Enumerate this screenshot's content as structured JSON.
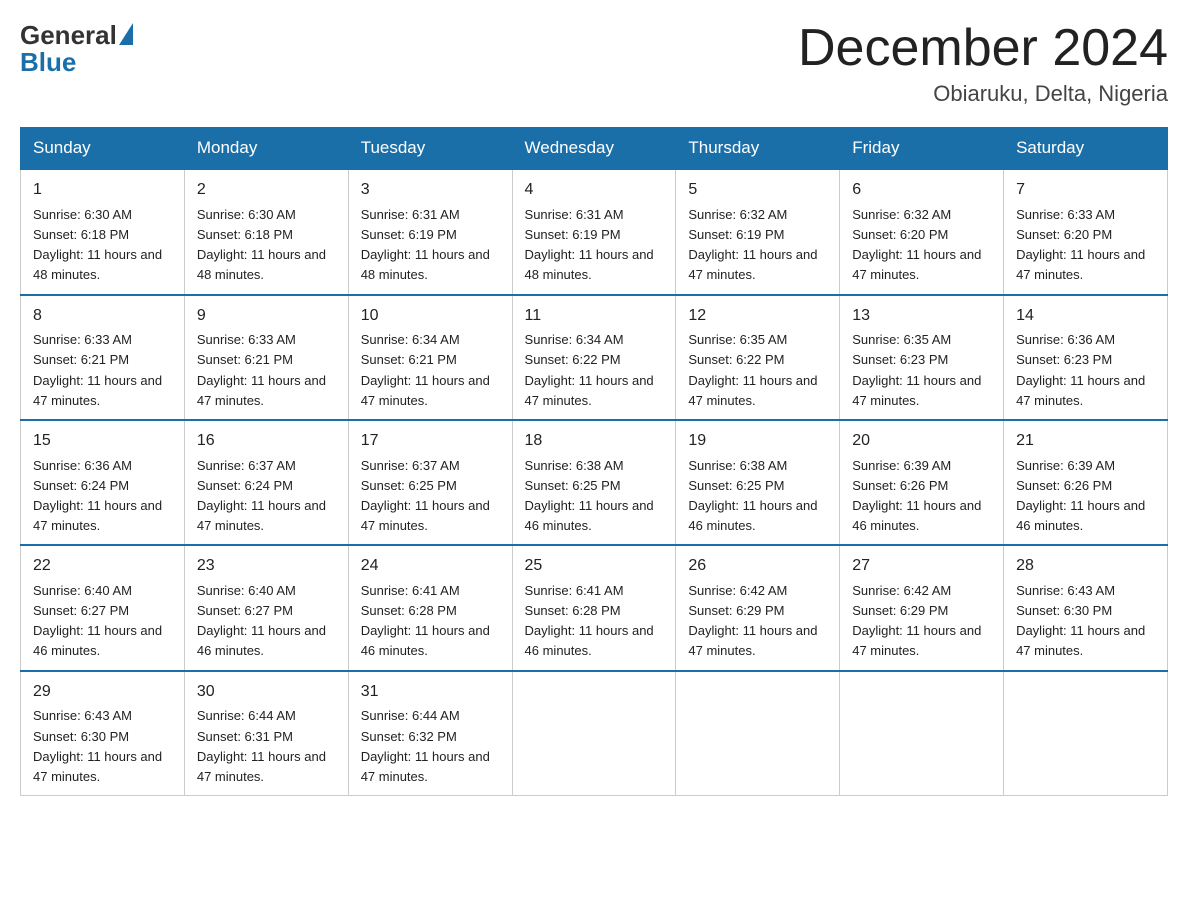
{
  "header": {
    "logo": {
      "general": "General",
      "blue": "Blue"
    },
    "title": "December 2024",
    "location": "Obiaruku, Delta, Nigeria"
  },
  "weekdays": [
    "Sunday",
    "Monday",
    "Tuesday",
    "Wednesday",
    "Thursday",
    "Friday",
    "Saturday"
  ],
  "weeks": [
    [
      {
        "day": "1",
        "sunrise": "6:30 AM",
        "sunset": "6:18 PM",
        "daylight": "11 hours and 48 minutes."
      },
      {
        "day": "2",
        "sunrise": "6:30 AM",
        "sunset": "6:18 PM",
        "daylight": "11 hours and 48 minutes."
      },
      {
        "day": "3",
        "sunrise": "6:31 AM",
        "sunset": "6:19 PM",
        "daylight": "11 hours and 48 minutes."
      },
      {
        "day": "4",
        "sunrise": "6:31 AM",
        "sunset": "6:19 PM",
        "daylight": "11 hours and 48 minutes."
      },
      {
        "day": "5",
        "sunrise": "6:32 AM",
        "sunset": "6:19 PM",
        "daylight": "11 hours and 47 minutes."
      },
      {
        "day": "6",
        "sunrise": "6:32 AM",
        "sunset": "6:20 PM",
        "daylight": "11 hours and 47 minutes."
      },
      {
        "day": "7",
        "sunrise": "6:33 AM",
        "sunset": "6:20 PM",
        "daylight": "11 hours and 47 minutes."
      }
    ],
    [
      {
        "day": "8",
        "sunrise": "6:33 AM",
        "sunset": "6:21 PM",
        "daylight": "11 hours and 47 minutes."
      },
      {
        "day": "9",
        "sunrise": "6:33 AM",
        "sunset": "6:21 PM",
        "daylight": "11 hours and 47 minutes."
      },
      {
        "day": "10",
        "sunrise": "6:34 AM",
        "sunset": "6:21 PM",
        "daylight": "11 hours and 47 minutes."
      },
      {
        "day": "11",
        "sunrise": "6:34 AM",
        "sunset": "6:22 PM",
        "daylight": "11 hours and 47 minutes."
      },
      {
        "day": "12",
        "sunrise": "6:35 AM",
        "sunset": "6:22 PM",
        "daylight": "11 hours and 47 minutes."
      },
      {
        "day": "13",
        "sunrise": "6:35 AM",
        "sunset": "6:23 PM",
        "daylight": "11 hours and 47 minutes."
      },
      {
        "day": "14",
        "sunrise": "6:36 AM",
        "sunset": "6:23 PM",
        "daylight": "11 hours and 47 minutes."
      }
    ],
    [
      {
        "day": "15",
        "sunrise": "6:36 AM",
        "sunset": "6:24 PM",
        "daylight": "11 hours and 47 minutes."
      },
      {
        "day": "16",
        "sunrise": "6:37 AM",
        "sunset": "6:24 PM",
        "daylight": "11 hours and 47 minutes."
      },
      {
        "day": "17",
        "sunrise": "6:37 AM",
        "sunset": "6:25 PM",
        "daylight": "11 hours and 47 minutes."
      },
      {
        "day": "18",
        "sunrise": "6:38 AM",
        "sunset": "6:25 PM",
        "daylight": "11 hours and 46 minutes."
      },
      {
        "day": "19",
        "sunrise": "6:38 AM",
        "sunset": "6:25 PM",
        "daylight": "11 hours and 46 minutes."
      },
      {
        "day": "20",
        "sunrise": "6:39 AM",
        "sunset": "6:26 PM",
        "daylight": "11 hours and 46 minutes."
      },
      {
        "day": "21",
        "sunrise": "6:39 AM",
        "sunset": "6:26 PM",
        "daylight": "11 hours and 46 minutes."
      }
    ],
    [
      {
        "day": "22",
        "sunrise": "6:40 AM",
        "sunset": "6:27 PM",
        "daylight": "11 hours and 46 minutes."
      },
      {
        "day": "23",
        "sunrise": "6:40 AM",
        "sunset": "6:27 PM",
        "daylight": "11 hours and 46 minutes."
      },
      {
        "day": "24",
        "sunrise": "6:41 AM",
        "sunset": "6:28 PM",
        "daylight": "11 hours and 46 minutes."
      },
      {
        "day": "25",
        "sunrise": "6:41 AM",
        "sunset": "6:28 PM",
        "daylight": "11 hours and 46 minutes."
      },
      {
        "day": "26",
        "sunrise": "6:42 AM",
        "sunset": "6:29 PM",
        "daylight": "11 hours and 47 minutes."
      },
      {
        "day": "27",
        "sunrise": "6:42 AM",
        "sunset": "6:29 PM",
        "daylight": "11 hours and 47 minutes."
      },
      {
        "day": "28",
        "sunrise": "6:43 AM",
        "sunset": "6:30 PM",
        "daylight": "11 hours and 47 minutes."
      }
    ],
    [
      {
        "day": "29",
        "sunrise": "6:43 AM",
        "sunset": "6:30 PM",
        "daylight": "11 hours and 47 minutes."
      },
      {
        "day": "30",
        "sunrise": "6:44 AM",
        "sunset": "6:31 PM",
        "daylight": "11 hours and 47 minutes."
      },
      {
        "day": "31",
        "sunrise": "6:44 AM",
        "sunset": "6:32 PM",
        "daylight": "11 hours and 47 minutes."
      },
      null,
      null,
      null,
      null
    ]
  ]
}
